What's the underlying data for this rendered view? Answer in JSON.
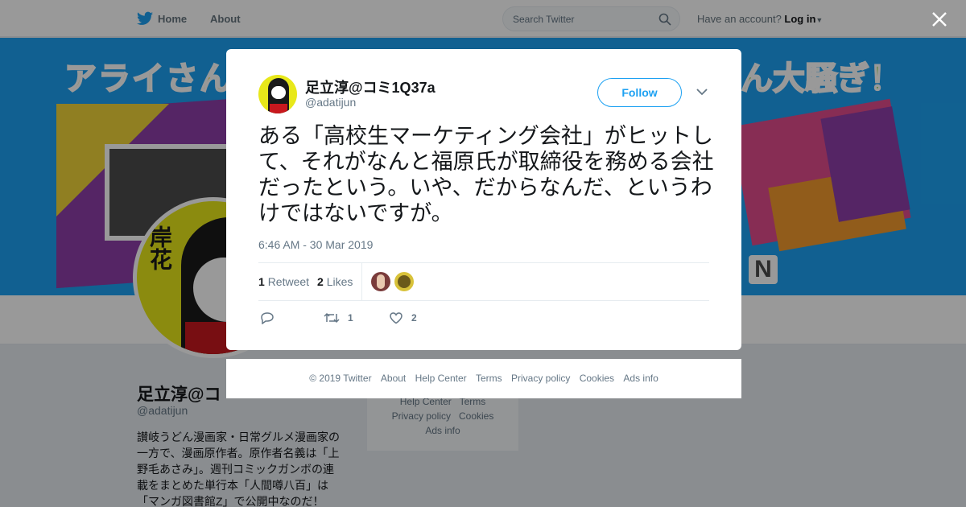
{
  "nav": {
    "home_label": "Home",
    "about_label": "About",
    "search_placeholder": "Search Twitter",
    "account_prompt": "Have an account?",
    "login_label": "Log in"
  },
  "banner": {
    "title_left": "アライさん",
    "title_right": "ん大騒ぎ！",
    "letter": "N"
  },
  "profile": {
    "name": "足立淳@コ",
    "handle": "@adatijun",
    "bio": "讃岐うどん漫画家・日常グルメ漫画家の一方で、漫画原作者。原作者名義は「上野毛あさみ」。週刊コミックガンボの連載をまとめた単行本「人間噂八百」は「マンガ図書館Z」で公開中なのだ！",
    "avatar_text": "岸花"
  },
  "side_links": [
    "Help Center",
    "Terms",
    "Privacy policy",
    "Cookies",
    "Ads info"
  ],
  "tweet": {
    "name": "足立淳@コミ1Q37a",
    "handle": "@adatijun",
    "follow_label": "Follow",
    "text": "ある「高校生マーケティング会社」がヒットして、それがなんと福原氏が取締役を務める会社だったという。いや、だからなんだ、というわけではないですが。",
    "timestamp": "6:46 AM - 30 Mar 2019",
    "retweet_count": "1",
    "retweet_label": "Retweet",
    "like_count": "2",
    "like_label": "Likes",
    "action_retweets": "1",
    "action_likes": "2"
  },
  "footer": {
    "copyright": "© 2019 Twitter",
    "links": [
      "About",
      "Help Center",
      "Terms",
      "Privacy policy",
      "Cookies",
      "Ads info"
    ]
  },
  "colors": {
    "accent": "#1da1f2",
    "banner_blue": "#1da1f2",
    "avatar_yellow": "#e8e81a"
  }
}
